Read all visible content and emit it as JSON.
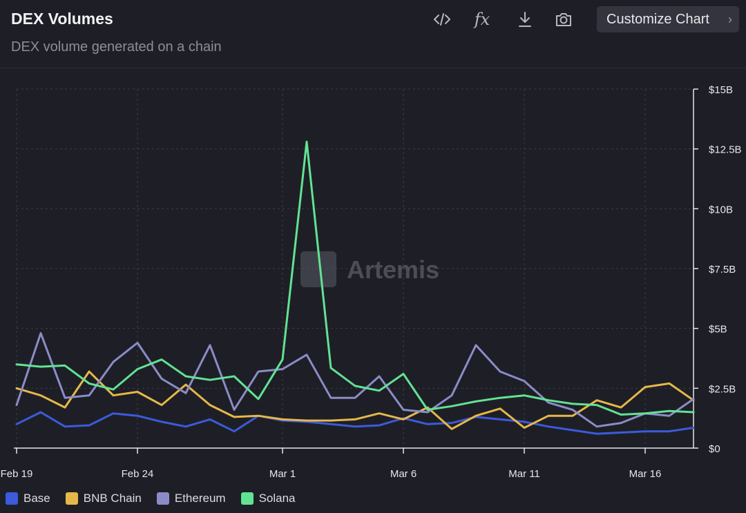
{
  "header": {
    "title": "DEX Volumes",
    "subtitle": "DEX volume generated on a chain",
    "customize_label": "Customize Chart"
  },
  "toolbar_icons": [
    "code-icon",
    "fx-icon",
    "download-icon",
    "camera-icon"
  ],
  "watermark": "Artemis",
  "chart_data": {
    "type": "line",
    "title": "DEX Volumes",
    "subtitle": "DEX volume generated on a chain",
    "x": [
      "Feb 19",
      "Feb 20",
      "Feb 21",
      "Feb 22",
      "Feb 23",
      "Feb 24",
      "Feb 25",
      "Feb 26",
      "Feb 27",
      "Feb 28",
      "Feb 29",
      "Mar 1",
      "Mar 2",
      "Mar 3",
      "Mar 4",
      "Mar 5",
      "Mar 6",
      "Mar 7",
      "Mar 8",
      "Mar 9",
      "Mar 10",
      "Mar 11",
      "Mar 12",
      "Mar 13",
      "Mar 14",
      "Mar 15",
      "Mar 16",
      "Mar 17",
      "Mar 18"
    ],
    "x_tick_labels": [
      "Feb 19",
      "Feb 24",
      "Mar 1",
      "Mar 6",
      "Mar 11",
      "Mar 16"
    ],
    "y_ticks": [
      0,
      2.5,
      5,
      7.5,
      10,
      12.5,
      15
    ],
    "y_tick_labels": [
      "$0",
      "$2.5B",
      "$5B",
      "$7.5B",
      "$10B",
      "$12.5B",
      "$15B"
    ],
    "ylim": [
      0,
      15
    ],
    "y_unit": "USD billions",
    "y_axis_side": "right",
    "grid": true,
    "legend_position": "bottom-left",
    "series": [
      {
        "name": "Base",
        "color": "#3b5bdb",
        "values": [
          1.0,
          1.5,
          0.9,
          0.95,
          1.45,
          1.35,
          1.1,
          0.9,
          1.2,
          0.7,
          1.35,
          1.15,
          1.1,
          1.0,
          0.9,
          0.95,
          1.25,
          1.0,
          1.05,
          1.3,
          1.2,
          1.1,
          0.9,
          0.75,
          0.6,
          0.65,
          0.7,
          0.7,
          0.85
        ]
      },
      {
        "name": "BNB Chain",
        "color": "#e6b84a",
        "values": [
          2.5,
          2.2,
          1.7,
          3.2,
          2.2,
          2.35,
          1.8,
          2.65,
          1.8,
          1.3,
          1.35,
          1.2,
          1.15,
          1.15,
          1.2,
          1.45,
          1.2,
          1.7,
          0.8,
          1.35,
          1.65,
          0.85,
          1.35,
          1.35,
          2.0,
          1.7,
          2.55,
          2.7,
          2.0
        ]
      },
      {
        "name": "Ethereum",
        "color": "#8b8cc7",
        "values": [
          1.8,
          4.8,
          2.1,
          2.2,
          3.6,
          4.4,
          2.9,
          2.3,
          4.3,
          1.6,
          3.2,
          3.3,
          3.9,
          2.1,
          2.1,
          3.0,
          1.6,
          1.5,
          2.2,
          4.3,
          3.2,
          2.8,
          1.9,
          1.6,
          0.9,
          1.05,
          1.45,
          1.35,
          2.05
        ]
      },
      {
        "name": "Solana",
        "color": "#62e394",
        "values": [
          3.5,
          3.4,
          3.45,
          2.7,
          2.45,
          3.3,
          3.7,
          3.0,
          2.85,
          3.0,
          2.05,
          3.7,
          12.8,
          3.35,
          2.6,
          2.4,
          3.1,
          1.6,
          1.75,
          1.95,
          2.1,
          2.2,
          2.0,
          1.85,
          1.8,
          1.4,
          1.45,
          1.55,
          1.5
        ]
      }
    ]
  }
}
